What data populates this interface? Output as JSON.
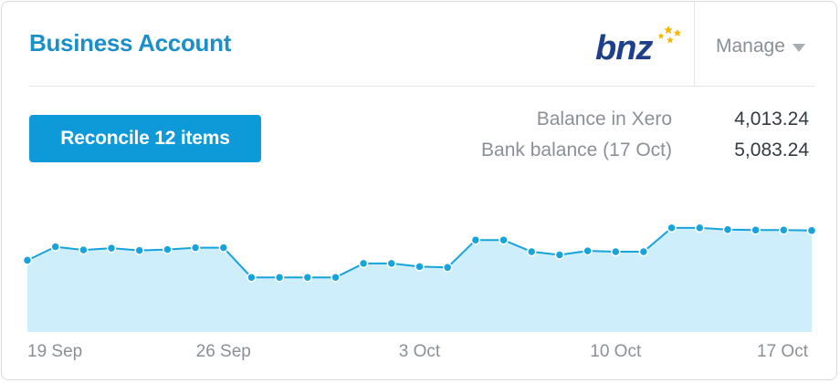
{
  "header": {
    "title": "Business Account",
    "bank_logo_text": "bnz",
    "manage_label": "Manage"
  },
  "actions": {
    "reconcile_label": "Reconcile 12 items"
  },
  "balances": [
    {
      "label": "Balance in Xero",
      "value": "4,013.24"
    },
    {
      "label": "Bank balance (17 Oct)",
      "value": "5,083.24"
    }
  ],
  "colors": {
    "accent": "#1a8fc9",
    "button": "#0e9ad8",
    "chart_line": "#17a3dc",
    "chart_fill": "#cdeefa"
  },
  "chart_data": {
    "type": "area",
    "x_ticks": [
      "19 Sep",
      "26 Sep",
      "3 Oct",
      "10 Oct",
      "17 Oct"
    ],
    "values": [
      4990,
      5290,
      5220,
      5260,
      5210,
      5230,
      5270,
      5270,
      4610,
      4610,
      4610,
      4610,
      4920,
      4920,
      4850,
      4830,
      5440,
      5440,
      5180,
      5110,
      5200,
      5180,
      5180,
      5710,
      5710,
      5670,
      5660,
      5660,
      5650
    ],
    "ylim": [
      3400,
      6800
    ],
    "grid": false
  }
}
